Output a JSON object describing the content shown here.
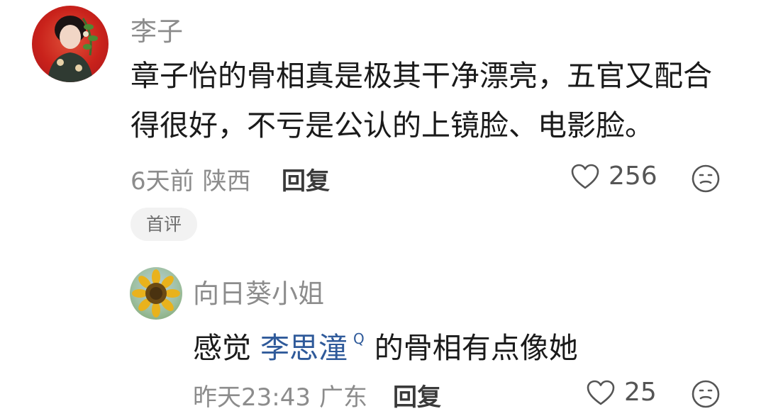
{
  "comment": {
    "username": "李子",
    "content_line1": "章子怡的骨相真是极其干净漂亮，五官又配合",
    "content_line2": "得很好，不亏是公认的上镜脸、电影脸。",
    "time": "6天前",
    "location": "陕西",
    "reply_label": "回复",
    "likes": "256",
    "tag": "首评"
  },
  "reply": {
    "username": "向日葵小姐",
    "content_prefix": "感觉",
    "mention": "李思潼",
    "mention_mark": "Q",
    "content_suffix": "的骨相有点像她",
    "time": "昨天23:43",
    "location": "广东",
    "reply_label": "回复",
    "likes": "25"
  },
  "icons": {
    "like": "heart-outline-icon",
    "dislike": "frown-face-icon"
  },
  "colors": {
    "text_primary": "#1a1a1a",
    "text_secondary": "#8c8c8c",
    "mention": "#2f5a9a",
    "tag_background": "#f2f2f2"
  }
}
